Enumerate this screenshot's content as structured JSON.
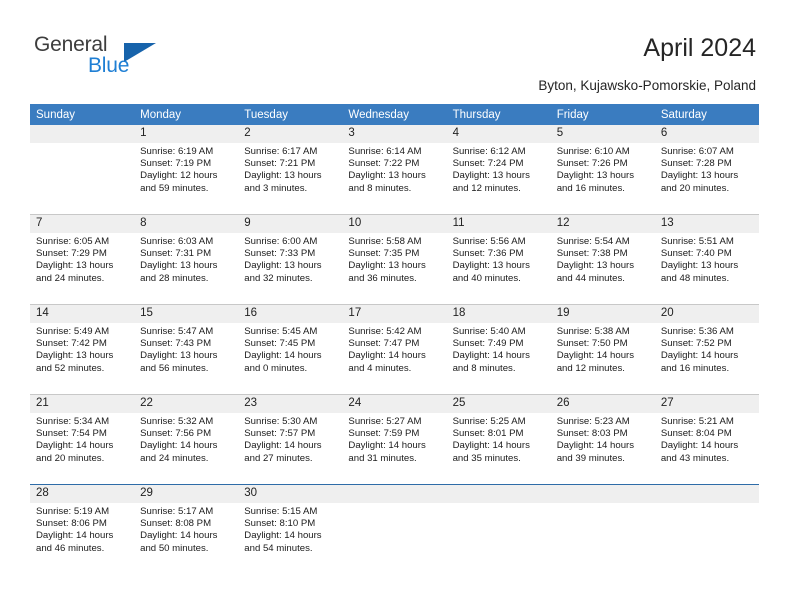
{
  "brand": {
    "name_top": "General",
    "name_bottom": "Blue",
    "triangle_icon": "triangle-logo-icon",
    "color_top": "#3d3d3d",
    "color_bottom": "#1f7fd4",
    "triangle_color": "#1763ab"
  },
  "header": {
    "title": "April 2024",
    "location": "Byton, Kujawsko-Pomorskie, Poland"
  },
  "theme": {
    "header_bg": "#3a7cc0",
    "daynum_bg": "#efefef",
    "grid_line": "#c8c8c8",
    "accent_line": "#2e6ca8"
  },
  "columns": [
    "Sunday",
    "Monday",
    "Tuesday",
    "Wednesday",
    "Thursday",
    "Friday",
    "Saturday"
  ],
  "labels": {
    "sunrise": "Sunrise:",
    "sunset": "Sunset:",
    "daylight": "Daylight:"
  },
  "weeks": [
    [
      {
        "day": "",
        "empty": true
      },
      {
        "day": "1",
        "sunrise": "Sunrise: 6:19 AM",
        "sunset": "Sunset: 7:19 PM",
        "daylight1": "Daylight: 12 hours",
        "daylight2": "and 59 minutes."
      },
      {
        "day": "2",
        "sunrise": "Sunrise: 6:17 AM",
        "sunset": "Sunset: 7:21 PM",
        "daylight1": "Daylight: 13 hours",
        "daylight2": "and 3 minutes."
      },
      {
        "day": "3",
        "sunrise": "Sunrise: 6:14 AM",
        "sunset": "Sunset: 7:22 PM",
        "daylight1": "Daylight: 13 hours",
        "daylight2": "and 8 minutes."
      },
      {
        "day": "4",
        "sunrise": "Sunrise: 6:12 AM",
        "sunset": "Sunset: 7:24 PM",
        "daylight1": "Daylight: 13 hours",
        "daylight2": "and 12 minutes."
      },
      {
        "day": "5",
        "sunrise": "Sunrise: 6:10 AM",
        "sunset": "Sunset: 7:26 PM",
        "daylight1": "Daylight: 13 hours",
        "daylight2": "and 16 minutes."
      },
      {
        "day": "6",
        "sunrise": "Sunrise: 6:07 AM",
        "sunset": "Sunset: 7:28 PM",
        "daylight1": "Daylight: 13 hours",
        "daylight2": "and 20 minutes."
      }
    ],
    [
      {
        "day": "7",
        "sunrise": "Sunrise: 6:05 AM",
        "sunset": "Sunset: 7:29 PM",
        "daylight1": "Daylight: 13 hours",
        "daylight2": "and 24 minutes."
      },
      {
        "day": "8",
        "sunrise": "Sunrise: 6:03 AM",
        "sunset": "Sunset: 7:31 PM",
        "daylight1": "Daylight: 13 hours",
        "daylight2": "and 28 minutes."
      },
      {
        "day": "9",
        "sunrise": "Sunrise: 6:00 AM",
        "sunset": "Sunset: 7:33 PM",
        "daylight1": "Daylight: 13 hours",
        "daylight2": "and 32 minutes."
      },
      {
        "day": "10",
        "sunrise": "Sunrise: 5:58 AM",
        "sunset": "Sunset: 7:35 PM",
        "daylight1": "Daylight: 13 hours",
        "daylight2": "and 36 minutes."
      },
      {
        "day": "11",
        "sunrise": "Sunrise: 5:56 AM",
        "sunset": "Sunset: 7:36 PM",
        "daylight1": "Daylight: 13 hours",
        "daylight2": "and 40 minutes."
      },
      {
        "day": "12",
        "sunrise": "Sunrise: 5:54 AM",
        "sunset": "Sunset: 7:38 PM",
        "daylight1": "Daylight: 13 hours",
        "daylight2": "and 44 minutes."
      },
      {
        "day": "13",
        "sunrise": "Sunrise: 5:51 AM",
        "sunset": "Sunset: 7:40 PM",
        "daylight1": "Daylight: 13 hours",
        "daylight2": "and 48 minutes."
      }
    ],
    [
      {
        "day": "14",
        "sunrise": "Sunrise: 5:49 AM",
        "sunset": "Sunset: 7:42 PM",
        "daylight1": "Daylight: 13 hours",
        "daylight2": "and 52 minutes."
      },
      {
        "day": "15",
        "sunrise": "Sunrise: 5:47 AM",
        "sunset": "Sunset: 7:43 PM",
        "daylight1": "Daylight: 13 hours",
        "daylight2": "and 56 minutes."
      },
      {
        "day": "16",
        "sunrise": "Sunrise: 5:45 AM",
        "sunset": "Sunset: 7:45 PM",
        "daylight1": "Daylight: 14 hours",
        "daylight2": "and 0 minutes."
      },
      {
        "day": "17",
        "sunrise": "Sunrise: 5:42 AM",
        "sunset": "Sunset: 7:47 PM",
        "daylight1": "Daylight: 14 hours",
        "daylight2": "and 4 minutes."
      },
      {
        "day": "18",
        "sunrise": "Sunrise: 5:40 AM",
        "sunset": "Sunset: 7:49 PM",
        "daylight1": "Daylight: 14 hours",
        "daylight2": "and 8 minutes."
      },
      {
        "day": "19",
        "sunrise": "Sunrise: 5:38 AM",
        "sunset": "Sunset: 7:50 PM",
        "daylight1": "Daylight: 14 hours",
        "daylight2": "and 12 minutes."
      },
      {
        "day": "20",
        "sunrise": "Sunrise: 5:36 AM",
        "sunset": "Sunset: 7:52 PM",
        "daylight1": "Daylight: 14 hours",
        "daylight2": "and 16 minutes."
      }
    ],
    [
      {
        "day": "21",
        "sunrise": "Sunrise: 5:34 AM",
        "sunset": "Sunset: 7:54 PM",
        "daylight1": "Daylight: 14 hours",
        "daylight2": "and 20 minutes."
      },
      {
        "day": "22",
        "sunrise": "Sunrise: 5:32 AM",
        "sunset": "Sunset: 7:56 PM",
        "daylight1": "Daylight: 14 hours",
        "daylight2": "and 24 minutes."
      },
      {
        "day": "23",
        "sunrise": "Sunrise: 5:30 AM",
        "sunset": "Sunset: 7:57 PM",
        "daylight1": "Daylight: 14 hours",
        "daylight2": "and 27 minutes."
      },
      {
        "day": "24",
        "sunrise": "Sunrise: 5:27 AM",
        "sunset": "Sunset: 7:59 PM",
        "daylight1": "Daylight: 14 hours",
        "daylight2": "and 31 minutes."
      },
      {
        "day": "25",
        "sunrise": "Sunrise: 5:25 AM",
        "sunset": "Sunset: 8:01 PM",
        "daylight1": "Daylight: 14 hours",
        "daylight2": "and 35 minutes."
      },
      {
        "day": "26",
        "sunrise": "Sunrise: 5:23 AM",
        "sunset": "Sunset: 8:03 PM",
        "daylight1": "Daylight: 14 hours",
        "daylight2": "and 39 minutes."
      },
      {
        "day": "27",
        "sunrise": "Sunrise: 5:21 AM",
        "sunset": "Sunset: 8:04 PM",
        "daylight1": "Daylight: 14 hours",
        "daylight2": "and 43 minutes."
      }
    ],
    [
      {
        "day": "28",
        "sunrise": "Sunrise: 5:19 AM",
        "sunset": "Sunset: 8:06 PM",
        "daylight1": "Daylight: 14 hours",
        "daylight2": "and 46 minutes."
      },
      {
        "day": "29",
        "sunrise": "Sunrise: 5:17 AM",
        "sunset": "Sunset: 8:08 PM",
        "daylight1": "Daylight: 14 hours",
        "daylight2": "and 50 minutes."
      },
      {
        "day": "30",
        "sunrise": "Sunrise: 5:15 AM",
        "sunset": "Sunset: 8:10 PM",
        "daylight1": "Daylight: 14 hours",
        "daylight2": "and 54 minutes."
      },
      {
        "day": "",
        "empty": true
      },
      {
        "day": "",
        "empty": true
      },
      {
        "day": "",
        "empty": true
      },
      {
        "day": "",
        "empty": true
      }
    ]
  ]
}
